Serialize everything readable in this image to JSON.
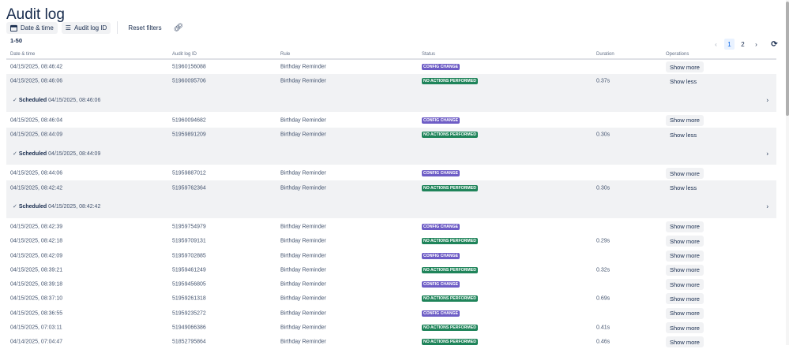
{
  "title": "Audit log",
  "toolbar": {
    "date_time": "Date & time",
    "audit_id": "Audit log ID",
    "reset": "Reset filters"
  },
  "range": "1-50",
  "pagination": {
    "prev": "‹",
    "pages": [
      "1",
      "2"
    ],
    "current": "1",
    "next": "›"
  },
  "columns": [
    "Date & time",
    "Audit log ID",
    "Rule",
    "Status",
    "Duration",
    "Operations"
  ],
  "status_colors": {
    "CONFIG CHANGE": "#6e5dc6",
    "NO ACTIONS PERFORMED": "#1f845a"
  },
  "detail_label": "Scheduled",
  "rows": [
    {
      "date": "04/15/2025, 08:46:42",
      "id": "51960156088",
      "rule": "Birthday Reminder",
      "status": "CONFIG CHANGE",
      "duration": "",
      "op": "Show more"
    },
    {
      "date": "04/15/2025, 08:46:06",
      "id": "51960095706",
      "rule": "Birthday Reminder",
      "status": "NO ACTIONS PERFORMED",
      "duration": "0.37s",
      "op": "Show less",
      "detail": "04/15/2025, 08:46:06"
    },
    {
      "date": "04/15/2025, 08:46:04",
      "id": "51960094682",
      "rule": "Birthday Reminder",
      "status": "CONFIG CHANGE",
      "duration": "",
      "op": "Show more"
    },
    {
      "date": "04/15/2025, 08:44:09",
      "id": "51959891209",
      "rule": "Birthday Reminder",
      "status": "NO ACTIONS PERFORMED",
      "duration": "0.30s",
      "op": "Show less",
      "detail": "04/15/2025, 08:44:09"
    },
    {
      "date": "04/15/2025, 08:44:06",
      "id": "51959887012",
      "rule": "Birthday Reminder",
      "status": "CONFIG CHANGE",
      "duration": "",
      "op": "Show more"
    },
    {
      "date": "04/15/2025, 08:42:42",
      "id": "51959762364",
      "rule": "Birthday Reminder",
      "status": "NO ACTIONS PERFORMED",
      "duration": "0.30s",
      "op": "Show less",
      "detail": "04/15/2025, 08:42:42"
    },
    {
      "date": "04/15/2025, 08:42:39",
      "id": "51959754979",
      "rule": "Birthday Reminder",
      "status": "CONFIG CHANGE",
      "duration": "",
      "op": "Show more"
    },
    {
      "date": "04/15/2025, 08:42:18",
      "id": "51959709131",
      "rule": "Birthday Reminder",
      "status": "NO ACTIONS PERFORMED",
      "duration": "0.29s",
      "op": "Show more"
    },
    {
      "date": "04/15/2025, 08:42:09",
      "id": "51959702885",
      "rule": "Birthday Reminder",
      "status": "CONFIG CHANGE",
      "duration": "",
      "op": "Show more"
    },
    {
      "date": "04/15/2025, 08:39:21",
      "id": "51959461249",
      "rule": "Birthday Reminder",
      "status": "NO ACTIONS PERFORMED",
      "duration": "0.32s",
      "op": "Show more"
    },
    {
      "date": "04/15/2025, 08:39:18",
      "id": "51959456805",
      "rule": "Birthday Reminder",
      "status": "CONFIG CHANGE",
      "duration": "",
      "op": "Show more"
    },
    {
      "date": "04/15/2025, 08:37:10",
      "id": "51959261318",
      "rule": "Birthday Reminder",
      "status": "NO ACTIONS PERFORMED",
      "duration": "0.69s",
      "op": "Show more"
    },
    {
      "date": "04/15/2025, 08:36:55",
      "id": "51959235272",
      "rule": "Birthday Reminder",
      "status": "CONFIG CHANGE",
      "duration": "",
      "op": "Show more"
    },
    {
      "date": "04/15/2025, 07:03:11",
      "id": "51949066386",
      "rule": "Birthday Reminder",
      "status": "NO ACTIONS PERFORMED",
      "duration": "0.41s",
      "op": "Show more"
    },
    {
      "date": "04/14/2025, 07:04:47",
      "id": "51852795864",
      "rule": "Birthday Reminder",
      "status": "NO ACTIONS PERFORMED",
      "duration": "0.46s",
      "op": "Show more"
    }
  ]
}
